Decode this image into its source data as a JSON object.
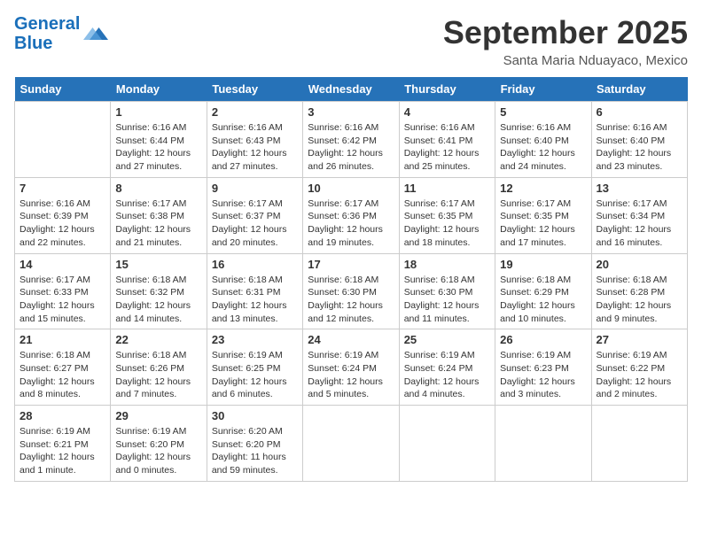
{
  "header": {
    "logo_line1": "General",
    "logo_line2": "Blue",
    "month_title": "September 2025",
    "location": "Santa Maria Nduayaco, Mexico"
  },
  "days_of_week": [
    "Sunday",
    "Monday",
    "Tuesday",
    "Wednesday",
    "Thursday",
    "Friday",
    "Saturday"
  ],
  "weeks": [
    [
      {
        "num": "",
        "info": ""
      },
      {
        "num": "1",
        "info": "Sunrise: 6:16 AM\nSunset: 6:44 PM\nDaylight: 12 hours\nand 27 minutes."
      },
      {
        "num": "2",
        "info": "Sunrise: 6:16 AM\nSunset: 6:43 PM\nDaylight: 12 hours\nand 27 minutes."
      },
      {
        "num": "3",
        "info": "Sunrise: 6:16 AM\nSunset: 6:42 PM\nDaylight: 12 hours\nand 26 minutes."
      },
      {
        "num": "4",
        "info": "Sunrise: 6:16 AM\nSunset: 6:41 PM\nDaylight: 12 hours\nand 25 minutes."
      },
      {
        "num": "5",
        "info": "Sunrise: 6:16 AM\nSunset: 6:40 PM\nDaylight: 12 hours\nand 24 minutes."
      },
      {
        "num": "6",
        "info": "Sunrise: 6:16 AM\nSunset: 6:40 PM\nDaylight: 12 hours\nand 23 minutes."
      }
    ],
    [
      {
        "num": "7",
        "info": "Sunrise: 6:16 AM\nSunset: 6:39 PM\nDaylight: 12 hours\nand 22 minutes."
      },
      {
        "num": "8",
        "info": "Sunrise: 6:17 AM\nSunset: 6:38 PM\nDaylight: 12 hours\nand 21 minutes."
      },
      {
        "num": "9",
        "info": "Sunrise: 6:17 AM\nSunset: 6:37 PM\nDaylight: 12 hours\nand 20 minutes."
      },
      {
        "num": "10",
        "info": "Sunrise: 6:17 AM\nSunset: 6:36 PM\nDaylight: 12 hours\nand 19 minutes."
      },
      {
        "num": "11",
        "info": "Sunrise: 6:17 AM\nSunset: 6:35 PM\nDaylight: 12 hours\nand 18 minutes."
      },
      {
        "num": "12",
        "info": "Sunrise: 6:17 AM\nSunset: 6:35 PM\nDaylight: 12 hours\nand 17 minutes."
      },
      {
        "num": "13",
        "info": "Sunrise: 6:17 AM\nSunset: 6:34 PM\nDaylight: 12 hours\nand 16 minutes."
      }
    ],
    [
      {
        "num": "14",
        "info": "Sunrise: 6:17 AM\nSunset: 6:33 PM\nDaylight: 12 hours\nand 15 minutes."
      },
      {
        "num": "15",
        "info": "Sunrise: 6:18 AM\nSunset: 6:32 PM\nDaylight: 12 hours\nand 14 minutes."
      },
      {
        "num": "16",
        "info": "Sunrise: 6:18 AM\nSunset: 6:31 PM\nDaylight: 12 hours\nand 13 minutes."
      },
      {
        "num": "17",
        "info": "Sunrise: 6:18 AM\nSunset: 6:30 PM\nDaylight: 12 hours\nand 12 minutes."
      },
      {
        "num": "18",
        "info": "Sunrise: 6:18 AM\nSunset: 6:30 PM\nDaylight: 12 hours\nand 11 minutes."
      },
      {
        "num": "19",
        "info": "Sunrise: 6:18 AM\nSunset: 6:29 PM\nDaylight: 12 hours\nand 10 minutes."
      },
      {
        "num": "20",
        "info": "Sunrise: 6:18 AM\nSunset: 6:28 PM\nDaylight: 12 hours\nand 9 minutes."
      }
    ],
    [
      {
        "num": "21",
        "info": "Sunrise: 6:18 AM\nSunset: 6:27 PM\nDaylight: 12 hours\nand 8 minutes."
      },
      {
        "num": "22",
        "info": "Sunrise: 6:18 AM\nSunset: 6:26 PM\nDaylight: 12 hours\nand 7 minutes."
      },
      {
        "num": "23",
        "info": "Sunrise: 6:19 AM\nSunset: 6:25 PM\nDaylight: 12 hours\nand 6 minutes."
      },
      {
        "num": "24",
        "info": "Sunrise: 6:19 AM\nSunset: 6:24 PM\nDaylight: 12 hours\nand 5 minutes."
      },
      {
        "num": "25",
        "info": "Sunrise: 6:19 AM\nSunset: 6:24 PM\nDaylight: 12 hours\nand 4 minutes."
      },
      {
        "num": "26",
        "info": "Sunrise: 6:19 AM\nSunset: 6:23 PM\nDaylight: 12 hours\nand 3 minutes."
      },
      {
        "num": "27",
        "info": "Sunrise: 6:19 AM\nSunset: 6:22 PM\nDaylight: 12 hours\nand 2 minutes."
      }
    ],
    [
      {
        "num": "28",
        "info": "Sunrise: 6:19 AM\nSunset: 6:21 PM\nDaylight: 12 hours\nand 1 minute."
      },
      {
        "num": "29",
        "info": "Sunrise: 6:19 AM\nSunset: 6:20 PM\nDaylight: 12 hours\nand 0 minutes."
      },
      {
        "num": "30",
        "info": "Sunrise: 6:20 AM\nSunset: 6:20 PM\nDaylight: 11 hours\nand 59 minutes."
      },
      {
        "num": "",
        "info": ""
      },
      {
        "num": "",
        "info": ""
      },
      {
        "num": "",
        "info": ""
      },
      {
        "num": "",
        "info": ""
      }
    ]
  ]
}
